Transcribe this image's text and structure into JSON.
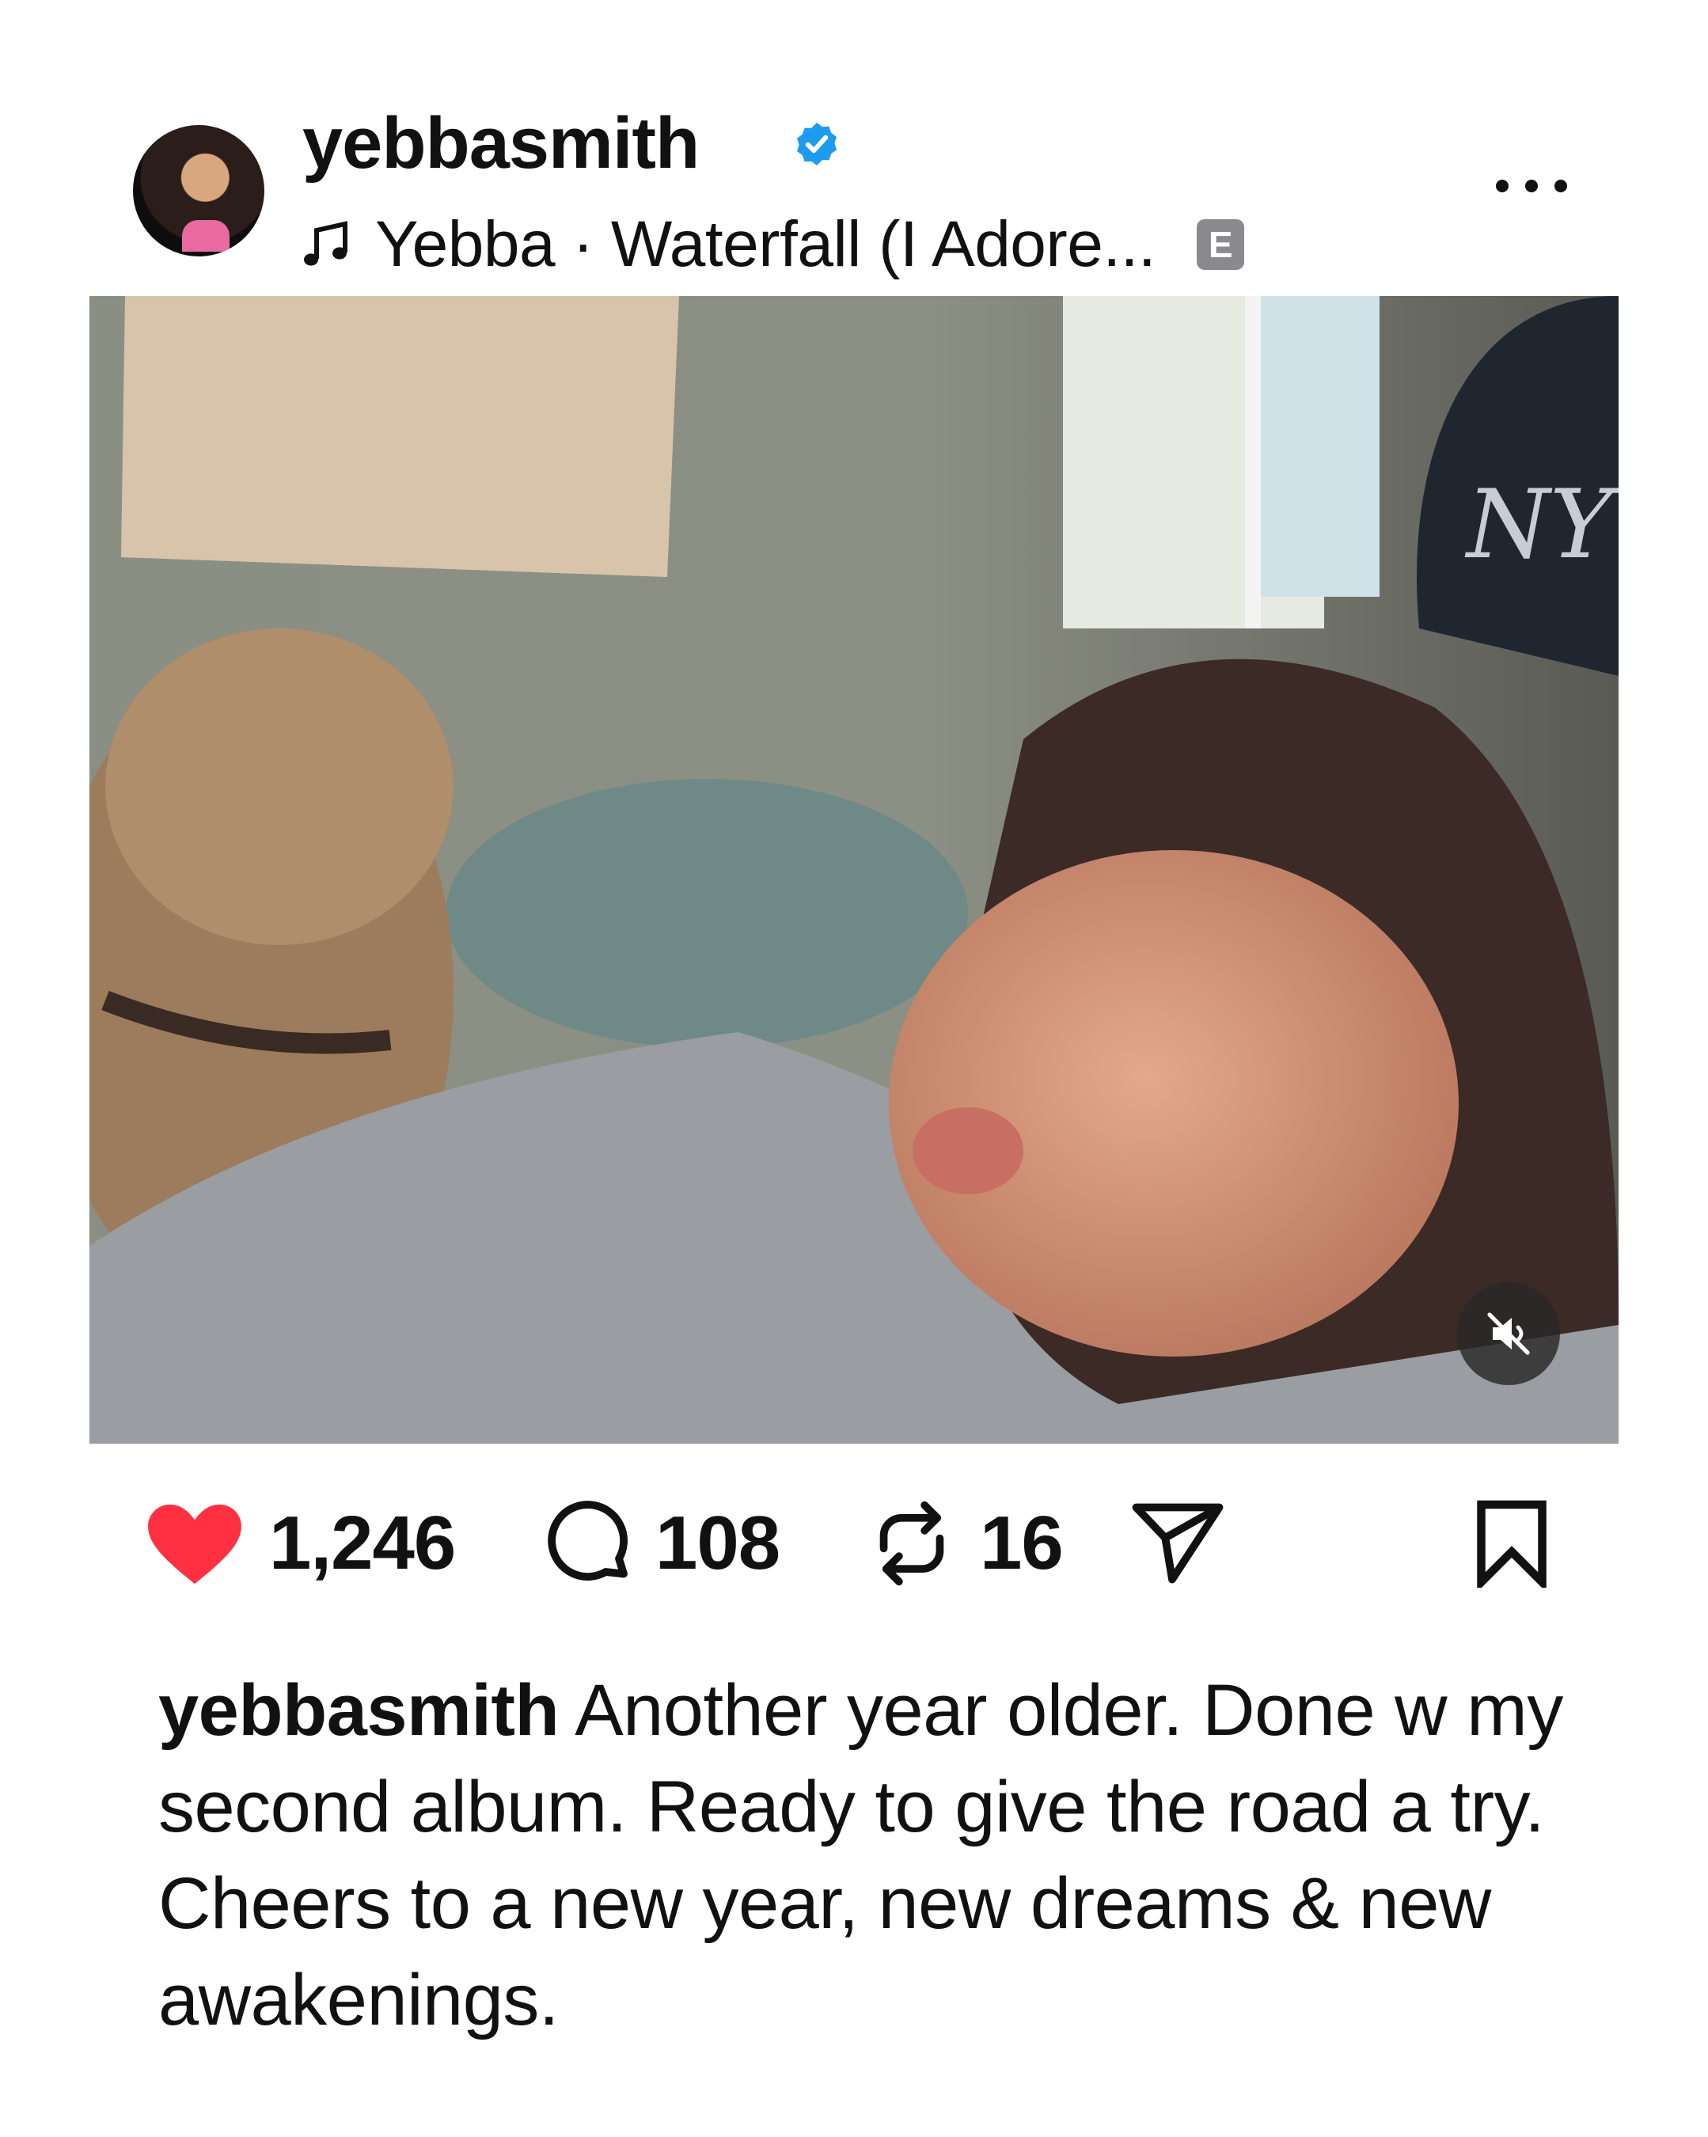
{
  "post": {
    "username": "yebbasmith",
    "verified": true,
    "music": {
      "artist": "Yebba",
      "separator": "·",
      "track": "Waterfall (I Adore...",
      "explicit_badge": "E"
    }
  },
  "actions": {
    "likes": "1,246",
    "comments": "108",
    "reposts": "16"
  },
  "caption": {
    "username": "yebbasmith",
    "text": "Another year older. Done w my second album. Ready to give the road a try. Cheers to a new year, new dreams & new awakenings."
  },
  "colors": {
    "like_red": "#ff3040",
    "verified_blue": "#1d9bf0",
    "text": "#111111",
    "badge_gray": "#8a8a8e"
  },
  "icons": [
    "music-note-icon",
    "verified-badge-icon",
    "more-icon",
    "mute-icon",
    "heart-icon",
    "comment-icon",
    "repost-icon",
    "share-icon",
    "bookmark-icon"
  ]
}
